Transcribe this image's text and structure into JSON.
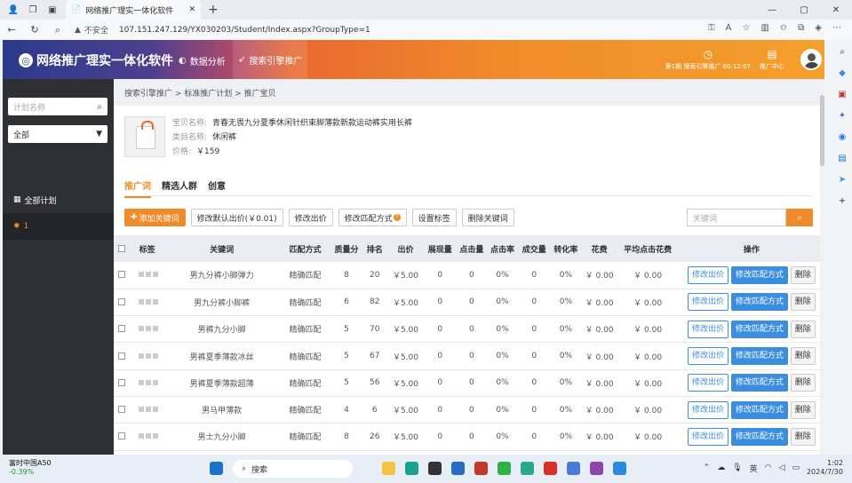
{
  "browser": {
    "tab_title": "网络推广理实一体化软件",
    "not_secure": "不安全",
    "url": "107.151.247.129/YX030203/Student/Index.aspx?GroupType=1"
  },
  "header": {
    "brand": "网络推广理实一体化软件",
    "nav": [
      "数据分析",
      "搜索引擎推广"
    ],
    "timer": "第1期 搜索引擎推广 00:12:07",
    "center": "推广中心"
  },
  "sidebar": {
    "search_placeholder": "计划名称",
    "select_value": "全部",
    "items": [
      "全部计划",
      "1"
    ]
  },
  "breadcrumb": "搜索引擎推广 > 标准推广计划 > 推广宝贝",
  "product": {
    "name_label": "宝贝名称:",
    "name": "青春无畏九分夏季休闲针织束脚薄款新款运动裤实用长裤",
    "category_label": "类目名称:",
    "category": "休闲裤",
    "price_label": "价格:",
    "price": "￥159"
  },
  "tabs": [
    "推广词",
    "精选人群",
    "创意"
  ],
  "toolbar": {
    "add": "添加关键词",
    "default_bid": "修改默认出价(￥0.01)",
    "modify_bid": "修改出价",
    "modify_match": "修改匹配方式",
    "set_tags": "设置标签",
    "delete_kw": "删除关键词",
    "kw_placeholder": "关键词"
  },
  "table": {
    "headers": [
      "标签",
      "关键词",
      "匹配方式",
      "质量分",
      "排名",
      "出价",
      "展现量",
      "点击量",
      "点击率",
      "成交量",
      "转化率",
      "花费",
      "平均点击花费",
      "操作"
    ],
    "actions": [
      "修改出价",
      "修改匹配方式",
      "删除"
    ],
    "rows": [
      {
        "kw": "男九分裤小脚弹力",
        "match": "精确匹配",
        "q": "8",
        "rank": "20",
        "bid": "￥5.00",
        "imp": "0",
        "clk": "0",
        "ctr": "0%",
        "deal": "0",
        "cvr": "0%",
        "cost": "￥ 0.00",
        "cpc": "￥ 0.00"
      },
      {
        "kw": "男九分裤小脚裤",
        "match": "精确匹配",
        "q": "6",
        "rank": "82",
        "bid": "￥5.00",
        "imp": "0",
        "clk": "0",
        "ctr": "0%",
        "deal": "0",
        "cvr": "0%",
        "cost": "￥ 0.00",
        "cpc": "￥ 0.00"
      },
      {
        "kw": "男裤九分小脚",
        "match": "精确匹配",
        "q": "5",
        "rank": "70",
        "bid": "￥5.00",
        "imp": "0",
        "clk": "0",
        "ctr": "0%",
        "deal": "0",
        "cvr": "0%",
        "cost": "￥ 0.00",
        "cpc": "￥ 0.00"
      },
      {
        "kw": "男裤夏季薄款冰丝",
        "match": "精确匹配",
        "q": "5",
        "rank": "67",
        "bid": "￥5.00",
        "imp": "0",
        "clk": "0",
        "ctr": "0%",
        "deal": "0",
        "cvr": "0%",
        "cost": "￥ 0.00",
        "cpc": "￥ 0.00"
      },
      {
        "kw": "男裤夏季薄款超薄",
        "match": "精确匹配",
        "q": "5",
        "rank": "56",
        "bid": "￥5.00",
        "imp": "0",
        "clk": "0",
        "ctr": "0%",
        "deal": "0",
        "cvr": "0%",
        "cost": "￥ 0.00",
        "cpc": "￥ 0.00"
      },
      {
        "kw": "男马甲薄款",
        "match": "精确匹配",
        "q": "4",
        "rank": "6",
        "bid": "￥5.00",
        "imp": "0",
        "clk": "0",
        "ctr": "0%",
        "deal": "0",
        "cvr": "0%",
        "cost": "￥ 0.00",
        "cpc": "￥ 0.00"
      },
      {
        "kw": "男士九分小脚",
        "match": "精确匹配",
        "q": "8",
        "rank": "26",
        "bid": "￥5.00",
        "imp": "0",
        "clk": "0",
        "ctr": "0%",
        "deal": "0",
        "cvr": "0%",
        "cost": "￥ 0.00",
        "cpc": "￥ 0.00"
      }
    ]
  },
  "taskbar": {
    "stock_name": "富时中国A50",
    "stock_change": "-0.39%",
    "search": "搜索",
    "ime": "英",
    "time": "1:02",
    "date": "2024/7/30"
  },
  "colors": {
    "accent": "#f08a2a",
    "blue": "#3b8de0",
    "sidebar": "#2f3033"
  }
}
